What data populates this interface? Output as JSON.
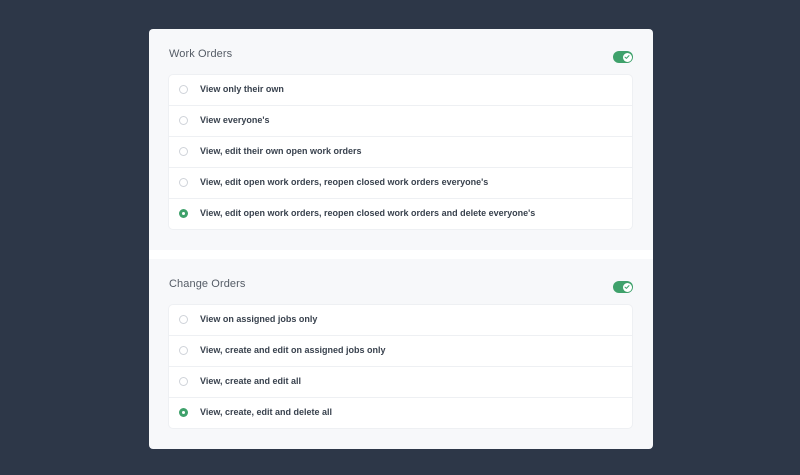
{
  "sections": [
    {
      "title": "Work Orders",
      "toggle_on": true,
      "options": [
        {
          "label": "View only their own",
          "selected": false
        },
        {
          "label": "View everyone's",
          "selected": false
        },
        {
          "label": "View, edit their own open work orders",
          "selected": false
        },
        {
          "label": "View, edit open work orders, reopen closed work orders everyone's",
          "selected": false
        },
        {
          "label": "View, edit open work orders, reopen closed work orders and delete everyone's",
          "selected": true
        }
      ]
    },
    {
      "title": "Change Orders",
      "toggle_on": true,
      "options": [
        {
          "label": "View on assigned jobs only",
          "selected": false
        },
        {
          "label": "View, create and edit on assigned jobs only",
          "selected": false
        },
        {
          "label": "View, create and edit all",
          "selected": false
        },
        {
          "label": "View, create, edit and delete all",
          "selected": true
        }
      ]
    }
  ],
  "colors": {
    "background": "#2d3748",
    "accent": "#3fa16b"
  },
  "icons": {
    "toggle_check": "check-icon"
  }
}
